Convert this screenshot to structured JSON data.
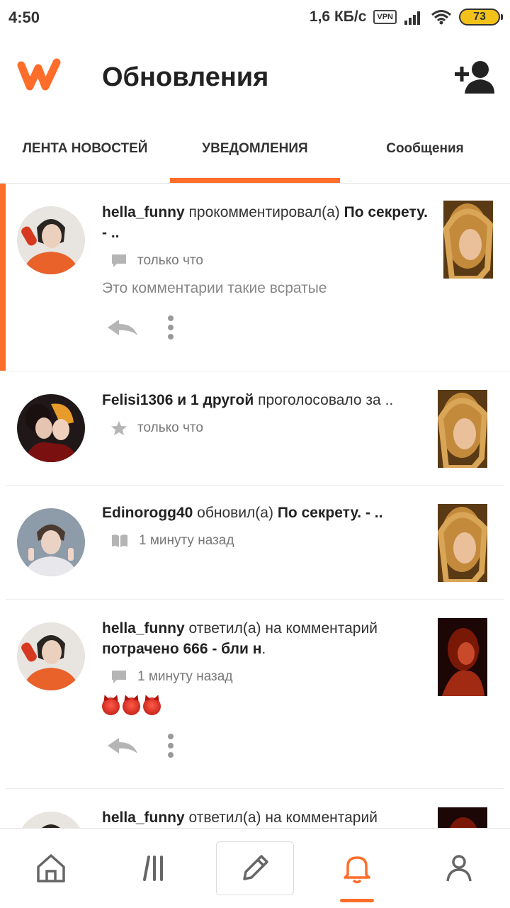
{
  "status_bar": {
    "time": "4:50",
    "speed": "1,6 КБ/с",
    "vpn": "VPN",
    "battery": "73"
  },
  "header": {
    "title": "Обновления",
    "add_user_icon": "add-user-icon"
  },
  "tabs": [
    {
      "label": "ЛЕНТА НОВОСТЕЙ"
    },
    {
      "label": "УВЕДОМЛЕНИЯ",
      "active": true
    },
    {
      "label": "Сообщения"
    }
  ],
  "notifications": [
    {
      "user": "hella_funny",
      "action": " прокомментировал(а) ",
      "target": "По секрету. - ..",
      "meta_icon": "comment-icon",
      "time": "только что",
      "comment": "Это комментарии такие всратые"
    },
    {
      "user": "Felisi1306 и 1 другой",
      "action": " проголосовало за ..",
      "target": "",
      "meta_icon": "star-icon",
      "time": "только что"
    },
    {
      "user": "Edinorogg40",
      "action": " обновил(а) ",
      "target": "По секрету. - ..",
      "meta_icon": "book-icon",
      "time": "1 минуту назад"
    },
    {
      "user": "hella_funny",
      "action": " ответил(а) на комментарий ",
      "target": "потрачено 666 - бли н",
      "target_suffix": ".",
      "meta_icon": "comment-icon",
      "time": "1 минуту назад",
      "emoji": "devil-emoji"
    },
    {
      "user": "hella_funny",
      "action": " ответил(а) на комментарий"
    }
  ],
  "bottom_nav": [
    "home-icon",
    "library-icon",
    "write-icon",
    "bell-icon",
    "profile-icon"
  ],
  "colors": {
    "accent": "#ff6d2a",
    "text": "#222222",
    "muted": "#888888"
  }
}
